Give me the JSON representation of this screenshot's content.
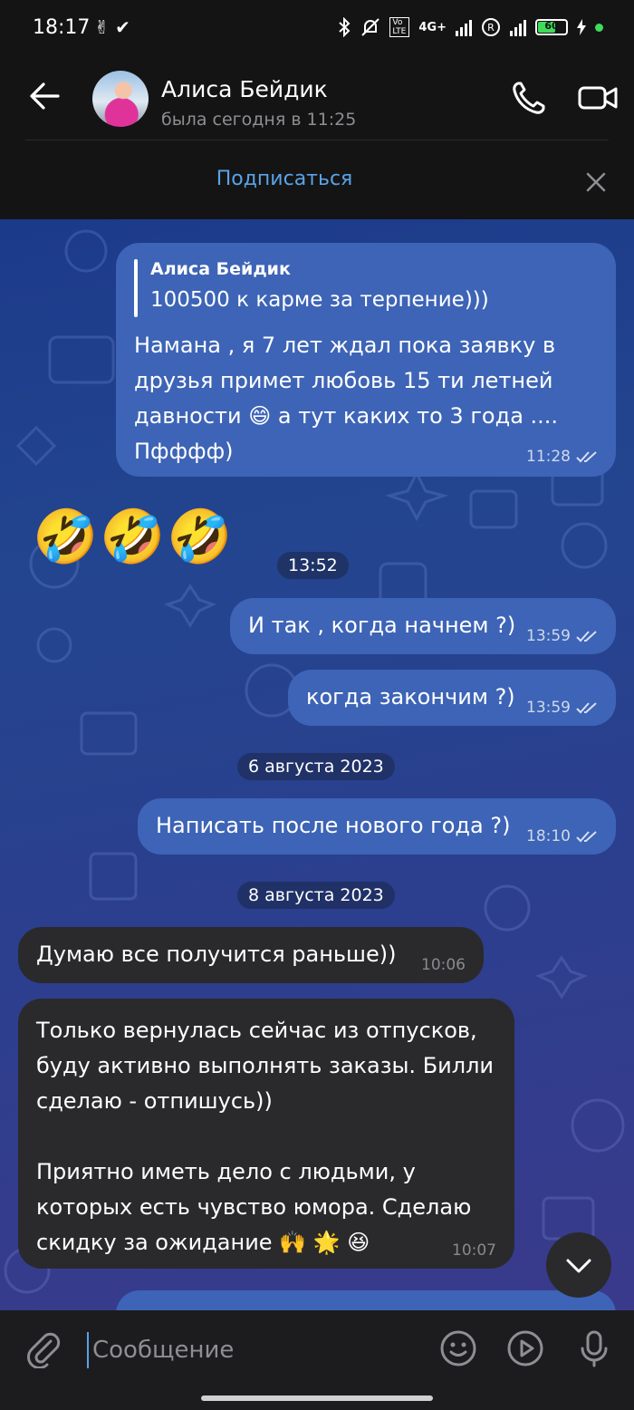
{
  "status_bar": {
    "time": "18:17",
    "left_icons": "✌ ✔",
    "network": "4G+",
    "volte": "Vo LTE",
    "battery": "60"
  },
  "header": {
    "contact_name": "Алиса Бейдик",
    "last_seen": "была сегодня в 11:25"
  },
  "subscribe_bar": {
    "label": "Подписаться"
  },
  "messages": {
    "m1": {
      "reply_name": "Алиса Бейдик",
      "reply_text": "100500 к карме за терпение)))",
      "line1": "Намана , я 7 лет ждал пока заявку в",
      "line2": "друзья примет любовь 15 ти летней",
      "line3": "давности 😄 а тут каких то 3 года ....",
      "line4": "Пфффф)",
      "time": "11:28"
    },
    "m2": {
      "emoji": "🤣🤣🤣",
      "time": "13:52"
    },
    "m3": {
      "text": "И так , когда начнем ?)",
      "time": "13:59"
    },
    "m4": {
      "text": "когда закончим ?)",
      "time": "13:59"
    },
    "date1": "6 августа 2023",
    "m5": {
      "text": "Написать после нового года ?)",
      "time": "18:10"
    },
    "date2": "8 августа 2023",
    "m6": {
      "text": "Думаю  все получится раньше))",
      "time": "10:06"
    },
    "m7": {
      "line1": "Только вернулась сейчас из отпусков,",
      "line2": "буду активно выполнять заказы. Билли",
      "line3": "сделаю - отпишусь))",
      "line4": "Приятно иметь дело с людьми, у",
      "line5": "которых есть чувство юмора. Сделаю",
      "line6": "скидку за ожидание 🙌 🌟 😆",
      "time": "10:07"
    }
  },
  "composer": {
    "placeholder": "Сообщение"
  },
  "colors": {
    "outgoing_bubble": "#3d64b6",
    "incoming_bubble": "#2a2a2c",
    "accent": "#5aa3e6"
  },
  "icons": [
    "back-arrow-icon",
    "phone-icon",
    "video-camera-icon",
    "close-icon",
    "chevron-down-icon",
    "paperclip-icon",
    "emoji-icon",
    "play-circle-icon",
    "microphone-icon",
    "double-check-icon"
  ]
}
